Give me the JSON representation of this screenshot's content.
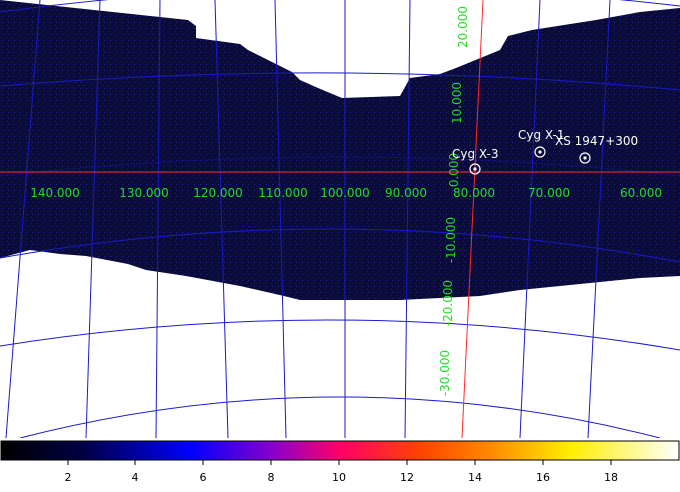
{
  "image": {
    "grid_color": "#1a1ac8",
    "axis_color": "#ff2a2a",
    "label_color": "#22dd22",
    "source_color": "#ffffff",
    "sky_color": "#0b0b38"
  },
  "longitude_labels": [
    "140.000",
    "130.000",
    "120.000",
    "110.000",
    "100.000",
    "90.000",
    "80.000",
    "70.000",
    "60.000"
  ],
  "latitude_labels": [
    "20.000",
    "10.000",
    "0.000",
    "-10.000",
    "-20.000",
    "-30.000"
  ],
  "sources": [
    {
      "name": "Cyg X-3"
    },
    {
      "name": "Cyg X-1"
    },
    {
      "name": "XS 1947+300"
    }
  ],
  "colorbar": {
    "ticks": [
      "2",
      "4",
      "6",
      "8",
      "10",
      "12",
      "14",
      "16",
      "18"
    ]
  }
}
